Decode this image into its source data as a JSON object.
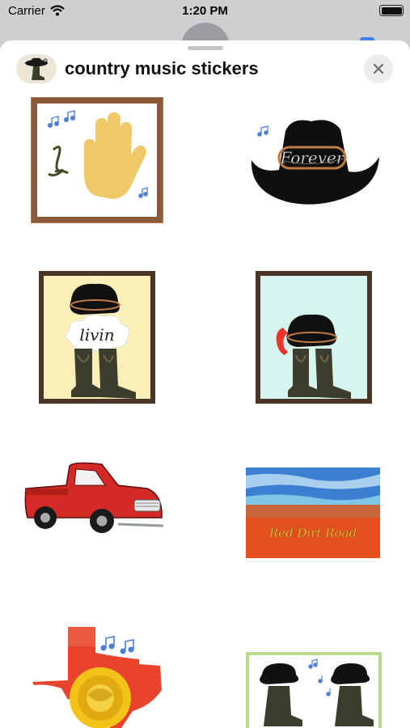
{
  "status": {
    "carrier": "Carrier",
    "time": "1:20 PM"
  },
  "sheet": {
    "title": "country music stickers",
    "app_icon": "cowboy-boot-app-icon",
    "close_icon": "close-icon"
  },
  "stickers": [
    {
      "name": "hand-lasso-frame",
      "text": ""
    },
    {
      "name": "forever-hat",
      "text": "Forever"
    },
    {
      "name": "livin-hat-boots",
      "text": "livin"
    },
    {
      "name": "phone-hat-boots",
      "text": ""
    },
    {
      "name": "red-pickup-truck",
      "text": ""
    },
    {
      "name": "red-dirt-road",
      "text": "Red Dirt Road"
    },
    {
      "name": "texas-yellow-rose",
      "text": ""
    },
    {
      "name": "two-hats-boots",
      "text": ""
    }
  ],
  "colors": {
    "frame_wood": "#8a5a3a",
    "hand_yellow": "#efc86a",
    "truck_red": "#d42a25",
    "road_orange": "#e2501d",
    "sky_blue": "#3a7fd0",
    "texas_red": "#e8432c",
    "rose_yellow": "#f2c417"
  }
}
